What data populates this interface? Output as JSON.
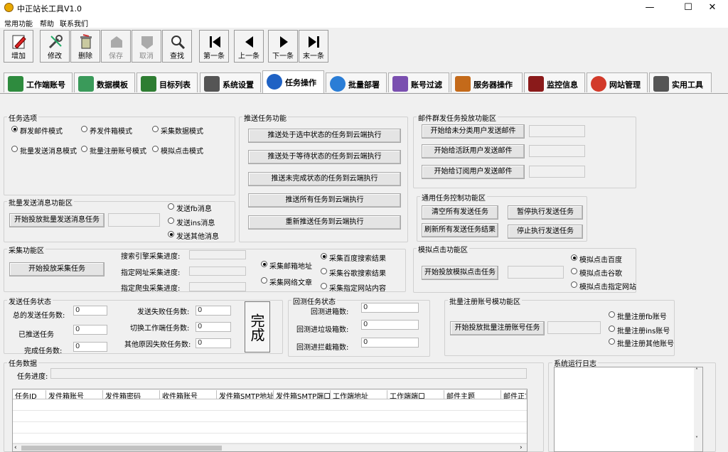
{
  "window": {
    "title": "中正站长工具V1.0",
    "min": "—",
    "max": "☐",
    "close": "✕"
  },
  "menu": [
    "常用功能",
    "帮助",
    "联系我们"
  ],
  "toolbar": [
    {
      "label": "增加",
      "icon": "pencil-edit-icon",
      "enabled": true
    },
    {
      "label": "修改",
      "icon": "tools-icon",
      "enabled": true
    },
    {
      "label": "删除",
      "icon": "trash-icon",
      "enabled": true
    },
    {
      "label": "保存",
      "icon": "save-icon",
      "enabled": false
    },
    {
      "label": "取消",
      "icon": "cancel-icon",
      "enabled": false
    },
    {
      "label": "查找",
      "icon": "search-icon",
      "enabled": true
    },
    {
      "label": "第一条",
      "icon": "first-record-icon",
      "enabled": true
    },
    {
      "label": "上一条",
      "icon": "previous-record-icon",
      "enabled": true
    },
    {
      "label": "下一条",
      "icon": "next-record-icon",
      "enabled": true
    },
    {
      "label": "末一条",
      "icon": "last-record-icon",
      "enabled": true
    }
  ],
  "tabs": [
    {
      "label": "工作端账号",
      "icon": "workstation-icon",
      "color": "#2e8b3e"
    },
    {
      "label": "数据模板",
      "icon": "template-icon",
      "color": "#3a9a5a"
    },
    {
      "label": "目标列表",
      "icon": "target-list-icon",
      "color": "#2e7d32"
    },
    {
      "label": "系统设置",
      "icon": "settings-icon",
      "color": "#555555"
    },
    {
      "label": "任务操作",
      "icon": "task-globe-icon",
      "color": "#1f62c4",
      "active": true
    },
    {
      "label": "批量部署",
      "icon": "deploy-icon",
      "color": "#2a7dd6"
    },
    {
      "label": "账号过滤",
      "icon": "filter-icon",
      "color": "#7a4fb0"
    },
    {
      "label": "服务器操作",
      "icon": "server-icon",
      "color": "#c46a1a"
    },
    {
      "label": "监控信息",
      "icon": "monitor-icon",
      "color": "#8a1a1a"
    },
    {
      "label": "网站管理",
      "icon": "browser-icon",
      "color": "#d23a2a"
    },
    {
      "label": "实用工具",
      "icon": "utility-icon",
      "color": "#555555"
    }
  ],
  "task_options": {
    "title": "任务选项",
    "options": [
      {
        "label": "群发邮件模式",
        "checked": true
      },
      {
        "label": "养发件箱模式",
        "checked": false
      },
      {
        "label": "采集数据模式",
        "checked": false
      },
      {
        "label": "批量发送消息模式",
        "checked": false
      },
      {
        "label": "批量注册账号模式",
        "checked": false
      },
      {
        "label": "模拟点击模式",
        "checked": false
      }
    ]
  },
  "push": {
    "title": "推送任务功能",
    "buttons": [
      "推送处于选中状态的任务到云端执行",
      "推送处于等待状态的任务到云端执行",
      "推送未完成状态的任务到云端执行",
      "推送所有任务到云端执行",
      "重新推送任务到云端执行"
    ]
  },
  "mail": {
    "title": "邮件群发任务投放功能区",
    "buttons": [
      "开始给未分类用户发送邮件",
      "开始给活跃用户发送邮件",
      "开始给订阅用户发送邮件"
    ]
  },
  "batch_msg": {
    "title": "批量发送消息功能区",
    "button": "开始投放批量发送消息任务",
    "options": [
      {
        "label": "发送fb消息",
        "checked": false
      },
      {
        "label": "发送ins消息",
        "checked": false
      },
      {
        "label": "发送其他消息",
        "checked": true
      }
    ]
  },
  "general": {
    "title": "通用任务控制功能区",
    "buttons": [
      "清空所有发送任务",
      "暂停执行发送任务",
      "刷新所有发送任务结果",
      "停止执行发送任务"
    ]
  },
  "collect": {
    "title": "采集功能区",
    "button": "开始投放采集任务",
    "progress_labels": [
      "搜索引擎采集进度:",
      "指定网址采集进度:",
      "指定爬虫采集进度:"
    ],
    "options1": [
      {
        "label": "采集邮箱地址",
        "checked": true
      },
      {
        "label": "采集网络文章",
        "checked": false
      }
    ],
    "options2": [
      {
        "label": "采集百度搜索结果",
        "checked": true
      },
      {
        "label": "采集谷歌搜索结果",
        "checked": false
      },
      {
        "label": "采集指定网站内容",
        "checked": false
      }
    ]
  },
  "click": {
    "title": "模拟点击功能区",
    "button": "开始投放模拟点击任务",
    "options": [
      {
        "label": "模拟点击百度",
        "checked": true
      },
      {
        "label": "模拟点击谷歌",
        "checked": false
      },
      {
        "label": "模拟点击指定网站",
        "checked": false
      }
    ]
  },
  "status": {
    "title": "发送任务状态",
    "left": [
      {
        "label": "总的发送任务数:",
        "value": "0"
      },
      {
        "label": "已推送任务",
        "value": "0"
      },
      {
        "label": "完成任务数:",
        "value": "0"
      }
    ],
    "mid": [
      {
        "label": "发送失败任务数:",
        "value": "0"
      },
      {
        "label": "切换工作端任务数:",
        "value": "0"
      },
      {
        "label": "其他原因失败任务数:",
        "value": "0"
      }
    ],
    "done": "完成"
  },
  "return_status": {
    "title": "回测任务状态",
    "rows": [
      {
        "label": "回测进箱数:",
        "value": "0"
      },
      {
        "label": "回测进垃圾箱数:",
        "value": "0"
      },
      {
        "label": "回测进拦截箱数:",
        "value": "0"
      }
    ]
  },
  "register": {
    "title": "批量注册账号模功能区",
    "button": "开始投放批量注册账号任务",
    "options": [
      {
        "label": "批量注册fb账号",
        "checked": false
      },
      {
        "label": "批量注册ins账号",
        "checked": false
      },
      {
        "label": "批量注册其他账号",
        "checked": false
      }
    ]
  },
  "task_data": {
    "title": "任务数据",
    "progress_label": "任务进度:",
    "columns": [
      "任务ID",
      "发件箱账号",
      "发件箱密码",
      "收件箱账号",
      "发件箱SMTP地址",
      "发件箱SMTP端口",
      "工作端地址",
      "工作端端口",
      "邮件主题",
      "邮件正文"
    ]
  },
  "log": {
    "title": "系统运行日志"
  }
}
